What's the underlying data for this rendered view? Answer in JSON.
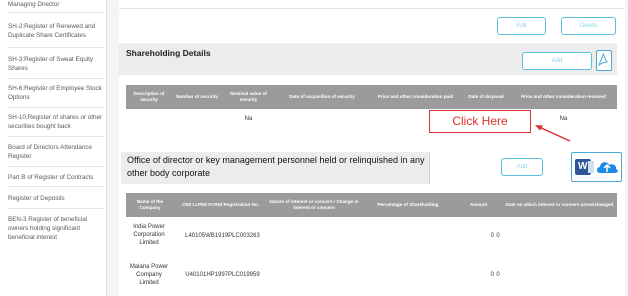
{
  "sidebar": {
    "items": [
      {
        "label": "Managing Director"
      },
      {
        "label": "SH-2:Register of Renewed and Duplicate Share Certificates"
      },
      {
        "label": "SH-3:Register of Sweat Equity Shares"
      },
      {
        "label": "SH-6:Register of Employee Stock Options"
      },
      {
        "label": "SH-10:Register of shares or other securities bought back"
      },
      {
        "label": "Board of Directors Attendance Register"
      },
      {
        "label": "Part B of Register of Contracts"
      },
      {
        "label": "Register of Deposits"
      },
      {
        "label": "BEN-3 Register of beneficial owners holding significant beneficial interest"
      }
    ]
  },
  "top_actions": {
    "edit_label": "Edit",
    "delete_label": "Delete"
  },
  "shareholding": {
    "title": "Shareholding Details",
    "add_label": "Add",
    "columns": [
      "Description of security",
      "Number of security",
      "Nominal value of security",
      "Date of acquisition of security",
      "Price and other consideration paid",
      "Date of disposal",
      "Price and other consideration received"
    ],
    "row": {
      "nominal": "Na",
      "received": "Na"
    }
  },
  "callout": {
    "text": "Click Here"
  },
  "office": {
    "title": "Office of director or key management personnel held or relinquished in any other body corporate",
    "add_label": "Add",
    "columns": [
      "Name of the Company",
      "CIN/ LLPIN/ FCRN/ Registration No.",
      "Nature of interest or concern / Change in interest or concern",
      "Percentage of Shareholding",
      "Amount",
      "Date on which interest or concern arose/changed"
    ],
    "rows": [
      {
        "company": "India Power Corporation Limited",
        "cin": "L40105WB1919PLC003263",
        "percentage": "0",
        "amount": "0"
      },
      {
        "company": "Malana Power Company Limited",
        "cin": "U40101HP1997PLC019959",
        "percentage": "0",
        "amount": "0"
      }
    ]
  },
  "colors": {
    "accent": "#5bc0de",
    "callout": "#d9312b",
    "header_gray": "#9b9b9b",
    "word_blue": "#2b579a",
    "cloud_blue": "#1e88e5"
  },
  "icons": [
    "pdf-icon",
    "word-icon",
    "cloud-upload-icon",
    "arrow-icon"
  ]
}
